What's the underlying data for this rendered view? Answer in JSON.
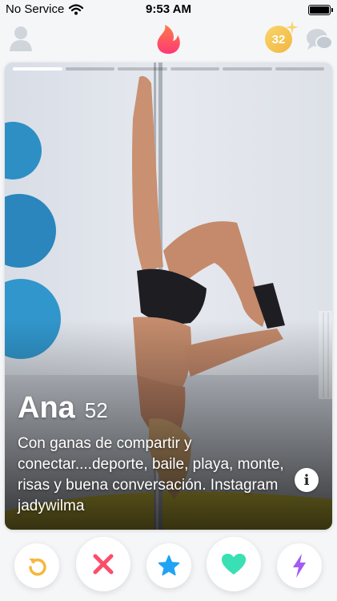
{
  "status_bar": {
    "carrier": "No Service",
    "time": "9:53 AM"
  },
  "top_nav": {
    "boost_count": "32"
  },
  "card": {
    "name": "Ana",
    "age": "52",
    "bio": "Con ganas de compartir y conectar....deporte, baile, playa, monte, risas y buena conversación. Instagram jadywilma",
    "info_symbol": "i",
    "photo_count": 6,
    "active_photo": 1
  },
  "actions": [
    "rewind-icon",
    "close-icon",
    "star-icon",
    "heart-icon",
    "lightning-icon"
  ],
  "colors": {
    "brand": "#fd5068",
    "rewind": "#f6b73c",
    "nope": "#fd4d6a",
    "superlike": "#1fa3f4",
    "like": "#38e0b4",
    "boost": "#a35bf3"
  }
}
